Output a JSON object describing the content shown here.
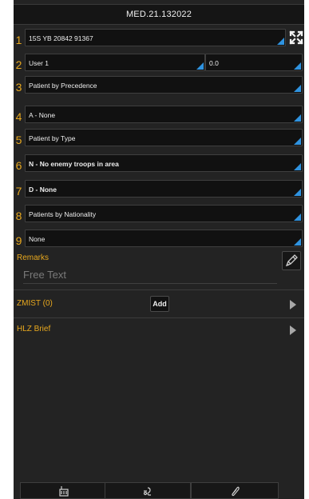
{
  "title": "MED.21.132022",
  "fields": [
    {
      "num": "1",
      "value": "15S YB 20842 91367"
    },
    {
      "num": "2",
      "value": "User 1",
      "secondary_value": "0.0"
    },
    {
      "num": "3",
      "value": "Patient by Precedence"
    },
    {
      "num": "4",
      "value": "A - None"
    },
    {
      "num": "5",
      "value": "Patient by Type"
    },
    {
      "num": "6",
      "value": "N - No enemy troops in area"
    },
    {
      "num": "7",
      "value": "D - None"
    },
    {
      "num": "8",
      "value": "Patients by Nationality"
    },
    {
      "num": "9",
      "value": "None"
    }
  ],
  "remarks": {
    "label": "Remarks",
    "placeholder": "Free Text"
  },
  "zmist": {
    "label": "ZMIST",
    "count": "(0)",
    "add_label": "Add"
  },
  "hlz": {
    "label": "HLZ Brief"
  },
  "icons": {
    "location": "crosshair-expand-icon",
    "edit": "pencil-edit-icon",
    "toolbar": [
      "radio-icon",
      "signal-icon",
      "attachment-icon"
    ]
  },
  "colors": {
    "accent": "#e8a81e",
    "dropdown_indicator": "#2f93e0",
    "background": "#232323",
    "field_bg": "#111111"
  }
}
